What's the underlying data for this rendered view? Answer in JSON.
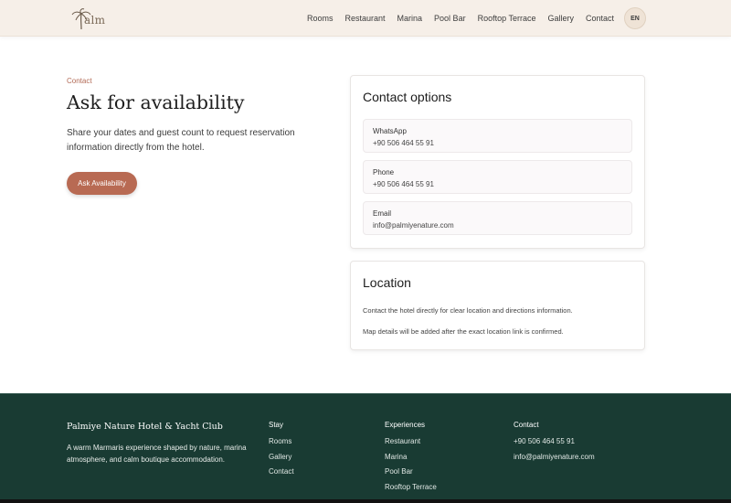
{
  "header": {
    "logo_text": "alm",
    "nav": [
      "Rooms",
      "Restaurant",
      "Marina",
      "Pool Bar",
      "Rooftop Terrace",
      "Gallery",
      "Contact"
    ],
    "lang": "EN"
  },
  "hero": {
    "eyebrow": "Contact",
    "title": "Ask for availability",
    "lead": "Share your dates and guest count to request reservation information directly from the hotel.",
    "cta": "Ask Availability"
  },
  "contact_card": {
    "title": "Contact options",
    "options": [
      {
        "label": "WhatsApp",
        "value": "+90 506 464 55 91"
      },
      {
        "label": "Phone",
        "value": "+90 506 464 55 91"
      },
      {
        "label": "Email",
        "value": "info@palmiyenature.com"
      }
    ]
  },
  "location_card": {
    "title": "Location",
    "text1": "Contact the hotel directly for clear location and directions information.",
    "text2": "Map details will be added after the exact location link is confirmed."
  },
  "footer": {
    "brand": "Palmiye Nature Hotel & Yacht Club",
    "tagline": "A warm Marmaris experience shaped by nature, marina atmosphere, and calm boutique accommodation.",
    "stay": {
      "title": "Stay",
      "links": [
        "Rooms",
        "Gallery",
        "Contact"
      ]
    },
    "experiences": {
      "title": "Experiences",
      "links": [
        "Restaurant",
        "Marina",
        "Pool Bar",
        "Rooftop Terrace"
      ]
    },
    "contact": {
      "title": "Contact",
      "links": [
        "+90 506 464 55 91",
        "info@palmiyenature.com"
      ]
    }
  },
  "colors": {
    "accent": "#b86a53",
    "header_bg": "#f6efe8",
    "footer_bg": "#193b33"
  }
}
